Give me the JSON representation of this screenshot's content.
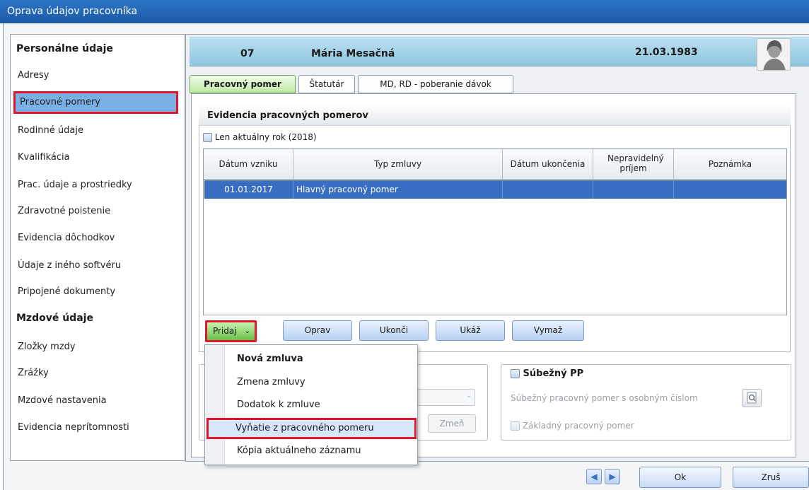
{
  "window": {
    "title": "Oprava údajov pracovníka"
  },
  "sidebar": {
    "section1": "Personálne údaje",
    "items1": [
      "Adresy",
      "Pracovné pomery",
      "Rodinné údaje",
      "Kvalifikácia",
      "Prac. údaje a prostriedky",
      "Zdravotné poistenie",
      "Evidencia dôchodkov",
      "Údaje z iného softvéru",
      "Pripojené dokumenty"
    ],
    "section2": "Mzdové údaje",
    "items2": [
      "Zložky mzdy",
      "Zrážky",
      "Mzdové nastavenia",
      "Evidencia neprítomnosti"
    ],
    "active": "Pracovné pomery"
  },
  "header": {
    "number": "07",
    "name": "Mária Mesačná",
    "date": "21.03.1983"
  },
  "tabs": [
    "Pracovný pomer",
    "Štatutár",
    "MD, RD - poberanie dávok"
  ],
  "evidence": {
    "title": "Evidencia pracovných pomerov",
    "checkbox_label": "Len aktuálny rok (2018)",
    "columns": [
      "Dátum vzniku",
      "Typ zmluvy",
      "Dátum ukončenia",
      "Nepravidelný príjem",
      "Poznámka"
    ],
    "rows": [
      {
        "start": "01.01.2017",
        "type": "Hlavný pracovný pomer",
        "end": "",
        "irregular": "",
        "note": ""
      }
    ]
  },
  "buttons": {
    "pridaj": "Pridaj",
    "oprav": "Oprav",
    "ukonci": "Ukonči",
    "ukaz": "Ukáž",
    "vymaz": "Vymaž",
    "zmen": "Zmeň",
    "ok": "Ok",
    "zrus": "Zruš"
  },
  "dropdown": {
    "items": [
      "Nová zmluva",
      "Zmena zmluvy",
      "Dodatok k zmluve",
      "Vyňatie z pracovného pomeru",
      "Kópia aktuálneho záznamu"
    ],
    "highlighted": "Vyňatie z pracovného pomeru"
  },
  "parallel": {
    "title": "Súbežný PP",
    "label": "Súbežný pracovný pomer s osobným číslom",
    "base_label": "Základný pracovný pomer"
  },
  "colors": {
    "accent": "#3a6ec2",
    "highlight_border": "#e0162b",
    "tab_active": "#bfe7a6"
  }
}
